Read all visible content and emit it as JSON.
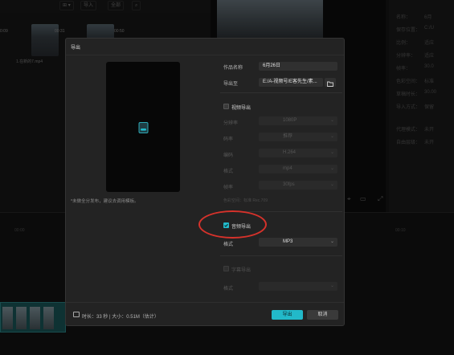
{
  "background": {
    "media_toolbar": {
      "import_label": "导入",
      "sort_label": "全部"
    },
    "media": {
      "items": [
        {
          "time": "0:09",
          "name": ""
        },
        {
          "time": "00:31",
          "name": "1.在新的7.mp4"
        },
        {
          "time": "00:50",
          "name": ""
        }
      ]
    },
    "properties": {
      "rows": [
        "名称：",
        "保存位置：",
        "比例：",
        "分辨率：",
        "帧率：",
        "色彩空间：",
        "草稿时长：",
        "导入方式：",
        "代理模式：",
        "自由层级："
      ],
      "values": [
        "6月",
        "C:/U",
        "适应",
        "适应",
        "30.0",
        "标准",
        "30.00",
        "保留",
        "未开",
        "未开"
      ]
    },
    "timeline": {
      "times": [
        "00:00",
        "00:10"
      ]
    }
  },
  "dialog": {
    "title": "导出",
    "cover_note": "*未做全分发布，建议去调用模板。",
    "work_name_label": "作品名称",
    "work_name_value": "6月26日",
    "export_to_label": "导出至",
    "export_to_value": "E:/A-视频号/E客先生/素...",
    "video_export": {
      "title": "视频导出",
      "enabled": false,
      "fields": [
        {
          "label": "分辨率",
          "value": "1080P"
        },
        {
          "label": "码率",
          "value": "推荐"
        },
        {
          "label": "编码",
          "value": "H.264"
        },
        {
          "label": "格式",
          "value": "mp4"
        },
        {
          "label": "帧率",
          "value": "30fps"
        }
      ],
      "rate_info": "色彩空间：标准 Rec.709"
    },
    "audio_export": {
      "title": "音频导出",
      "enabled": true,
      "format_label": "格式",
      "format_value": "MP3"
    },
    "subtitle_export": {
      "title": "字幕导出",
      "enabled": false,
      "format_label": "格式",
      "format_value": ""
    },
    "footer": {
      "info": "时长：33 秒 | 大小：0.51M（估计）",
      "export_label": "导出",
      "cancel_label": "取消"
    }
  },
  "colors": {
    "accent": "#22b9c9",
    "highlight": "#d6322b"
  }
}
